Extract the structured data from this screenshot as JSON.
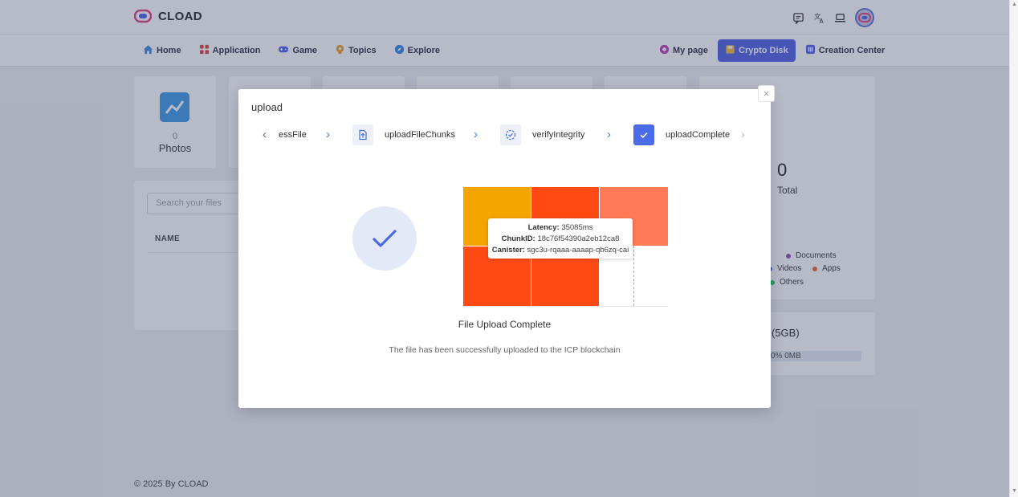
{
  "header": {
    "brand": "CLOAD",
    "icons": [
      "message-icon",
      "translate-icon",
      "laptop-icon",
      "avatar"
    ]
  },
  "nav": {
    "left": [
      {
        "label": "Home",
        "icon": "home-icon",
        "color": "#4a90e2"
      },
      {
        "label": "Application",
        "icon": "apps-icon",
        "color": "#e84b4b"
      },
      {
        "label": "Game",
        "icon": "gamepad-icon",
        "color": "#5a6ae8"
      },
      {
        "label": "Topics",
        "icon": "topics-icon",
        "color": "#f0a030"
      },
      {
        "label": "Explore",
        "icon": "compass-icon",
        "color": "#3a8ee8"
      }
    ],
    "right": [
      {
        "label": "My page",
        "icon": "my-page-icon",
        "color": "#c04ab8"
      },
      {
        "label": "Crypto Disk",
        "icon": "disk-icon",
        "color": "#f5c242",
        "active": true
      },
      {
        "label": "Creation Center",
        "icon": "creation-icon",
        "color": "#5a6ae8"
      }
    ]
  },
  "background": {
    "photos": {
      "count": "0",
      "label": "Photos"
    },
    "total": {
      "count": "0",
      "label": "Total"
    },
    "legend": [
      {
        "label": "Documents",
        "color": "#9b59b6"
      },
      {
        "label": "Videos",
        "color": "#5a6ae8"
      },
      {
        "label": "Apps",
        "color": "#e8703a"
      },
      {
        "label": "Others",
        "color": "#2ecc71"
      }
    ],
    "storage": {
      "title": "(5GB)",
      "bar_text": "0% 0MB"
    },
    "search_placeholder": "Search your files",
    "table_header": "NAME",
    "footer": "© 2025 By CLOAD"
  },
  "modal": {
    "title": "upload",
    "close_label": "×",
    "steps": [
      {
        "label": "essFile"
      },
      {
        "label": "uploadFileChunks",
        "icon": "upload-file-icon"
      },
      {
        "label": "verifyIntegrity",
        "icon": "verify-icon"
      },
      {
        "label": "uploadComplete",
        "icon": "check-icon",
        "done": true
      }
    ],
    "tooltip": {
      "latency_key": "Latency:",
      "latency_val": "35085ms",
      "chunk_key": "ChunkID:",
      "chunk_val": "18c76f54390a2eb12ca8",
      "canister_key": "Canister:",
      "canister_val": "sgc3u-rqaaa-aaaap-qb6zq-cai"
    },
    "success_title": "File Upload Complete",
    "success_desc": "The file has been successfully uploaded to the ICP blockchain"
  },
  "treemap_colors": [
    "#f5a500",
    "#ff4a14",
    "#ff7a55",
    "#ff4a14",
    "#ff4a14"
  ]
}
